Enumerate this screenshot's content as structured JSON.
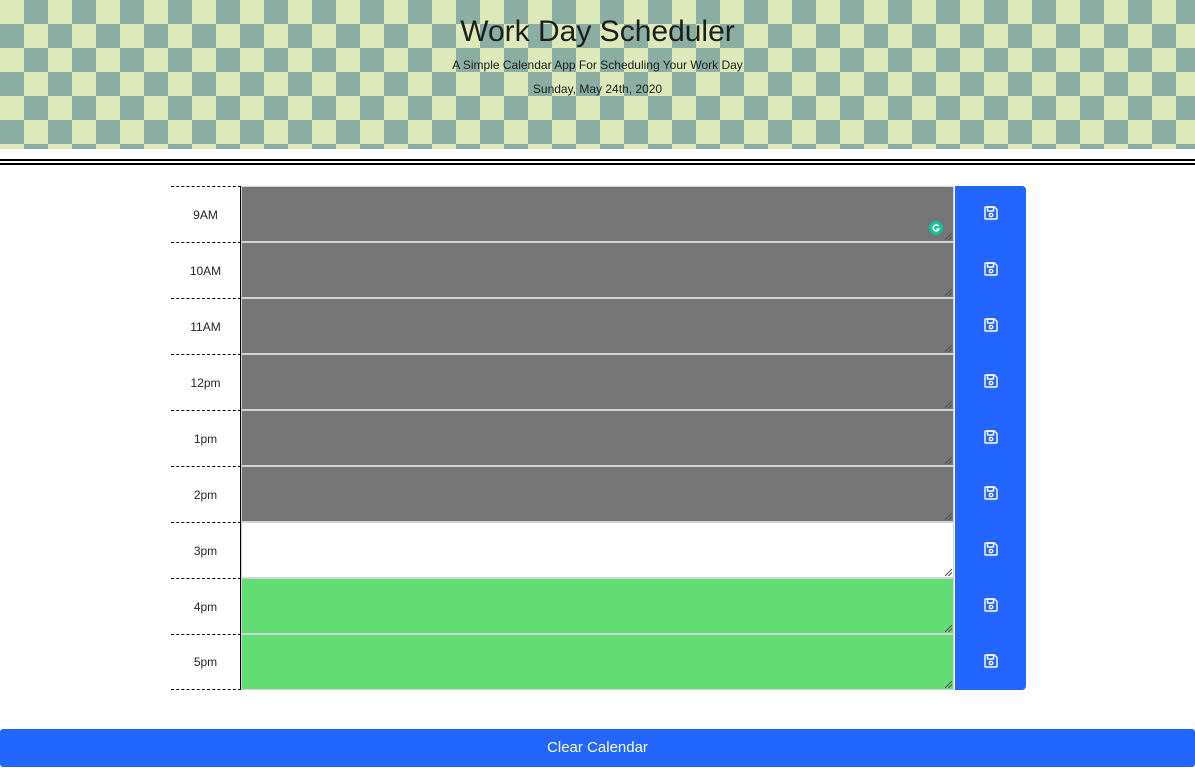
{
  "header": {
    "title": "Work Day Scheduler",
    "subtitle": "A Simple Calendar App For Scheduling Your Work Day",
    "date": "Sunday, May 24th, 2020"
  },
  "rows": [
    {
      "hour": "9AM",
      "state": "past",
      "text": ""
    },
    {
      "hour": "10AM",
      "state": "past",
      "text": ""
    },
    {
      "hour": "11AM",
      "state": "past",
      "text": ""
    },
    {
      "hour": "12pm",
      "state": "past",
      "text": ""
    },
    {
      "hour": "1pm",
      "state": "past",
      "text": ""
    },
    {
      "hour": "2pm",
      "state": "past",
      "text": ""
    },
    {
      "hour": "3pm",
      "state": "present",
      "text": ""
    },
    {
      "hour": "4pm",
      "state": "future",
      "text": ""
    },
    {
      "hour": "5pm",
      "state": "future",
      "text": ""
    }
  ],
  "icons": {
    "save": "floppy-disk-icon",
    "grammarly": "grammarly-icon"
  },
  "colors": {
    "past": "#757575",
    "present": "#ffffff",
    "future": "#62dd74",
    "button": "#2266ff"
  },
  "clear_button": {
    "label": "Clear Calendar"
  }
}
